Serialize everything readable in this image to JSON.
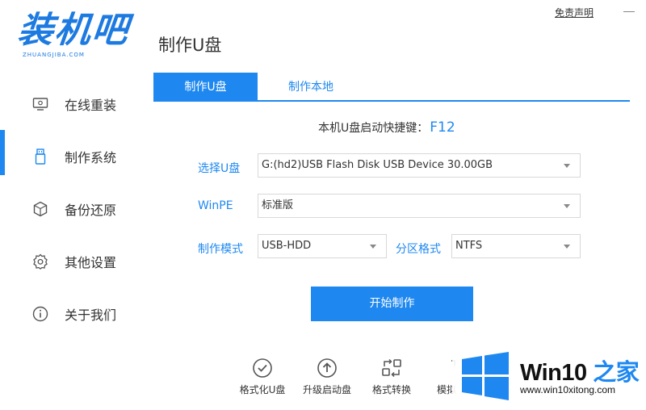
{
  "app": {
    "logo_text": "装机吧",
    "logo_sub": "ZHUANGJIBA.COM",
    "disclaimer": "免责声明"
  },
  "sidebar": {
    "items": [
      {
        "label": "在线重装",
        "icon": "monitor-icon"
      },
      {
        "label": "制作系统",
        "icon": "usb-drive-icon",
        "active": true
      },
      {
        "label": "备份还原",
        "icon": "cube-icon"
      },
      {
        "label": "其他设置",
        "icon": "gear-icon"
      },
      {
        "label": "关于我们",
        "icon": "info-icon"
      }
    ]
  },
  "header": {
    "title": "制作U盘"
  },
  "tabs": [
    {
      "label": "制作U盘",
      "active": true
    },
    {
      "label": "制作本地",
      "active": false
    }
  ],
  "form": {
    "shortcut_label": "本机U盘启动快捷键：",
    "shortcut_key": "F12",
    "usb_label": "选择U盘",
    "usb_value": "G:(hd2)USB Flash Disk USB Device 30.00GB",
    "winpe_label": "WinPE",
    "winpe_value": "标准版",
    "mode_label": "制作模式",
    "mode_value": "USB-HDD",
    "partition_label": "分区格式",
    "partition_value": "NTFS",
    "start_button": "开始制作"
  },
  "tools": [
    {
      "label": "格式化U盘",
      "icon": "check-circle-icon"
    },
    {
      "label": "升级启动盘",
      "icon": "upload-circle-icon"
    },
    {
      "label": "格式转换",
      "icon": "convert-icon"
    },
    {
      "label": "模拟",
      "icon": "simulate-icon"
    }
  ],
  "watermark": {
    "title_a": "Win10",
    "title_b": " 之家",
    "url": "www.win10xitong.com"
  },
  "colors": {
    "accent": "#1e88f0",
    "brand": "#1c7ae0"
  }
}
